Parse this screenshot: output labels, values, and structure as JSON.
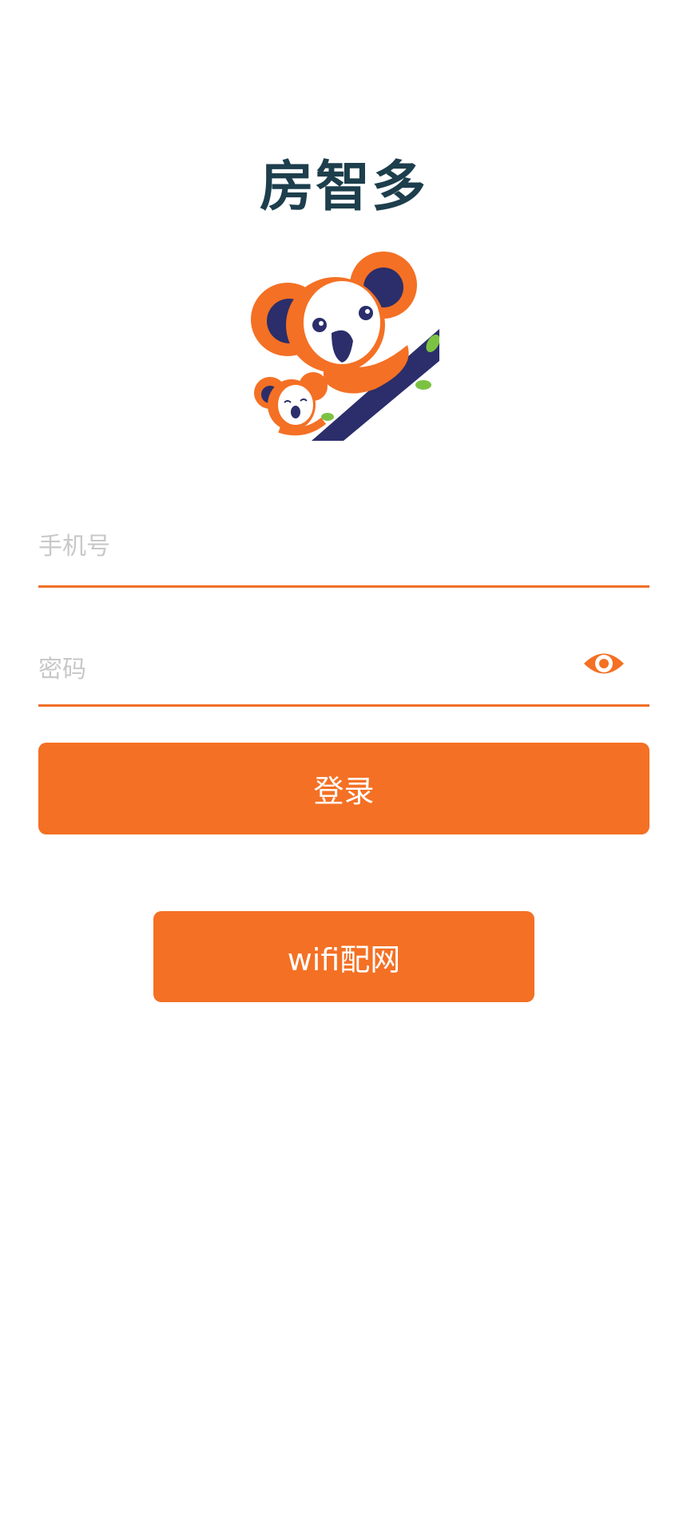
{
  "app": {
    "title": "房智多"
  },
  "logo": {
    "icon": "koala-logo-icon"
  },
  "form": {
    "phone_placeholder": "手机号",
    "password_placeholder": "密码",
    "show_password_icon": "eye-icon",
    "login_label": "登录",
    "wifi_label": "wifi配网"
  },
  "colors": {
    "accent": "#f47024",
    "title": "#1d3e4c",
    "placeholder": "#c8c8c8",
    "navy": "#2b2e6a"
  }
}
